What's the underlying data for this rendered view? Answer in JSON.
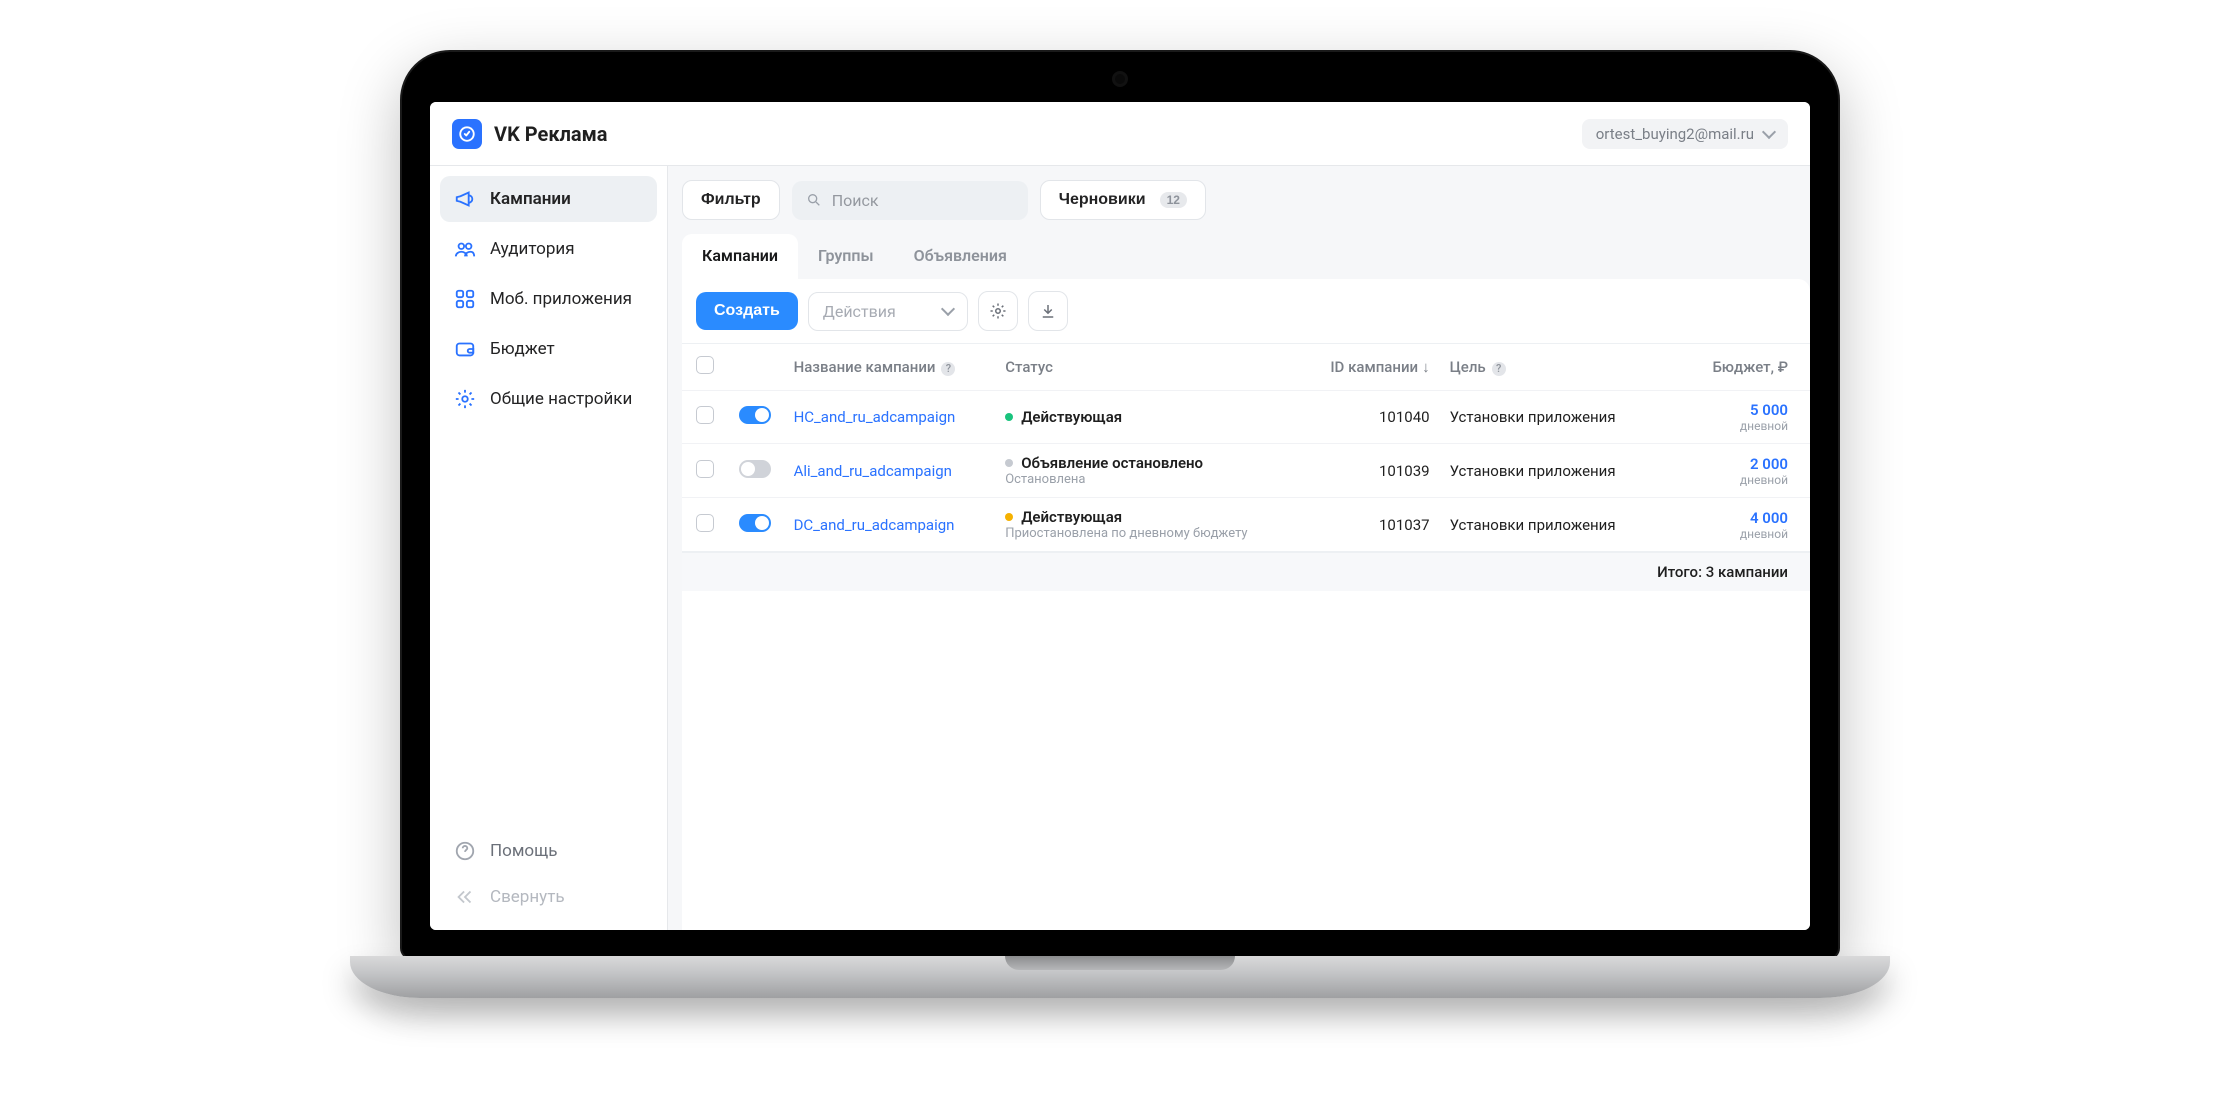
{
  "brand": {
    "title": "VK Реклама"
  },
  "account": {
    "email": "ortest_buying2@mail.ru"
  },
  "sidebar": {
    "items": [
      {
        "label": "Кампании",
        "active": true,
        "icon": "megaphone"
      },
      {
        "label": "Аудитория",
        "active": false,
        "icon": "people"
      },
      {
        "label": "Моб. приложения",
        "active": false,
        "icon": "apps"
      },
      {
        "label": "Бюджет",
        "active": false,
        "icon": "wallet"
      },
      {
        "label": "Общие настройки",
        "active": false,
        "icon": "gear"
      }
    ],
    "help_label": "Помощь",
    "collapse_label": "Свернуть"
  },
  "toolbar": {
    "filter_label": "Фильтр",
    "search_placeholder": "Поиск",
    "drafts_label": "Черновики",
    "drafts_count": "12"
  },
  "tabs": [
    {
      "label": "Кампании",
      "active": true
    },
    {
      "label": "Группы",
      "active": false
    },
    {
      "label": "Объявления",
      "active": false
    }
  ],
  "panel_toolbar": {
    "create_label": "Создать",
    "actions_label": "Действия"
  },
  "table": {
    "columns": {
      "name": "Название кампании",
      "status": "Статус",
      "id": "ID кампании",
      "goal": "Цель",
      "budget": "Бюджет, ₽"
    },
    "rows": [
      {
        "enabled": true,
        "name": "HC_and_ru_adcampaign",
        "status_title": "Действующая",
        "status_sub": "",
        "status_color": "green",
        "id": "101040",
        "goal": "Установки приложения",
        "budget": "5 000",
        "budget_sub": "дневной"
      },
      {
        "enabled": false,
        "name": "Ali_and_ru_adcampaign",
        "status_title": "Объявление остановлено",
        "status_sub": "Остановлена",
        "status_color": "grey",
        "id": "101039",
        "goal": "Установки приложения",
        "budget": "2 000",
        "budget_sub": "дневной"
      },
      {
        "enabled": true,
        "name": "DC_and_ru_adcampaign",
        "status_title": "Действующая",
        "status_sub": "Приостановлена по дневному бюджету",
        "status_color": "yellow",
        "id": "101037",
        "goal": "Установки приложения",
        "budget": "4 000",
        "budget_sub": "дневной"
      }
    ],
    "summary": "Итого: 3 кампании"
  }
}
